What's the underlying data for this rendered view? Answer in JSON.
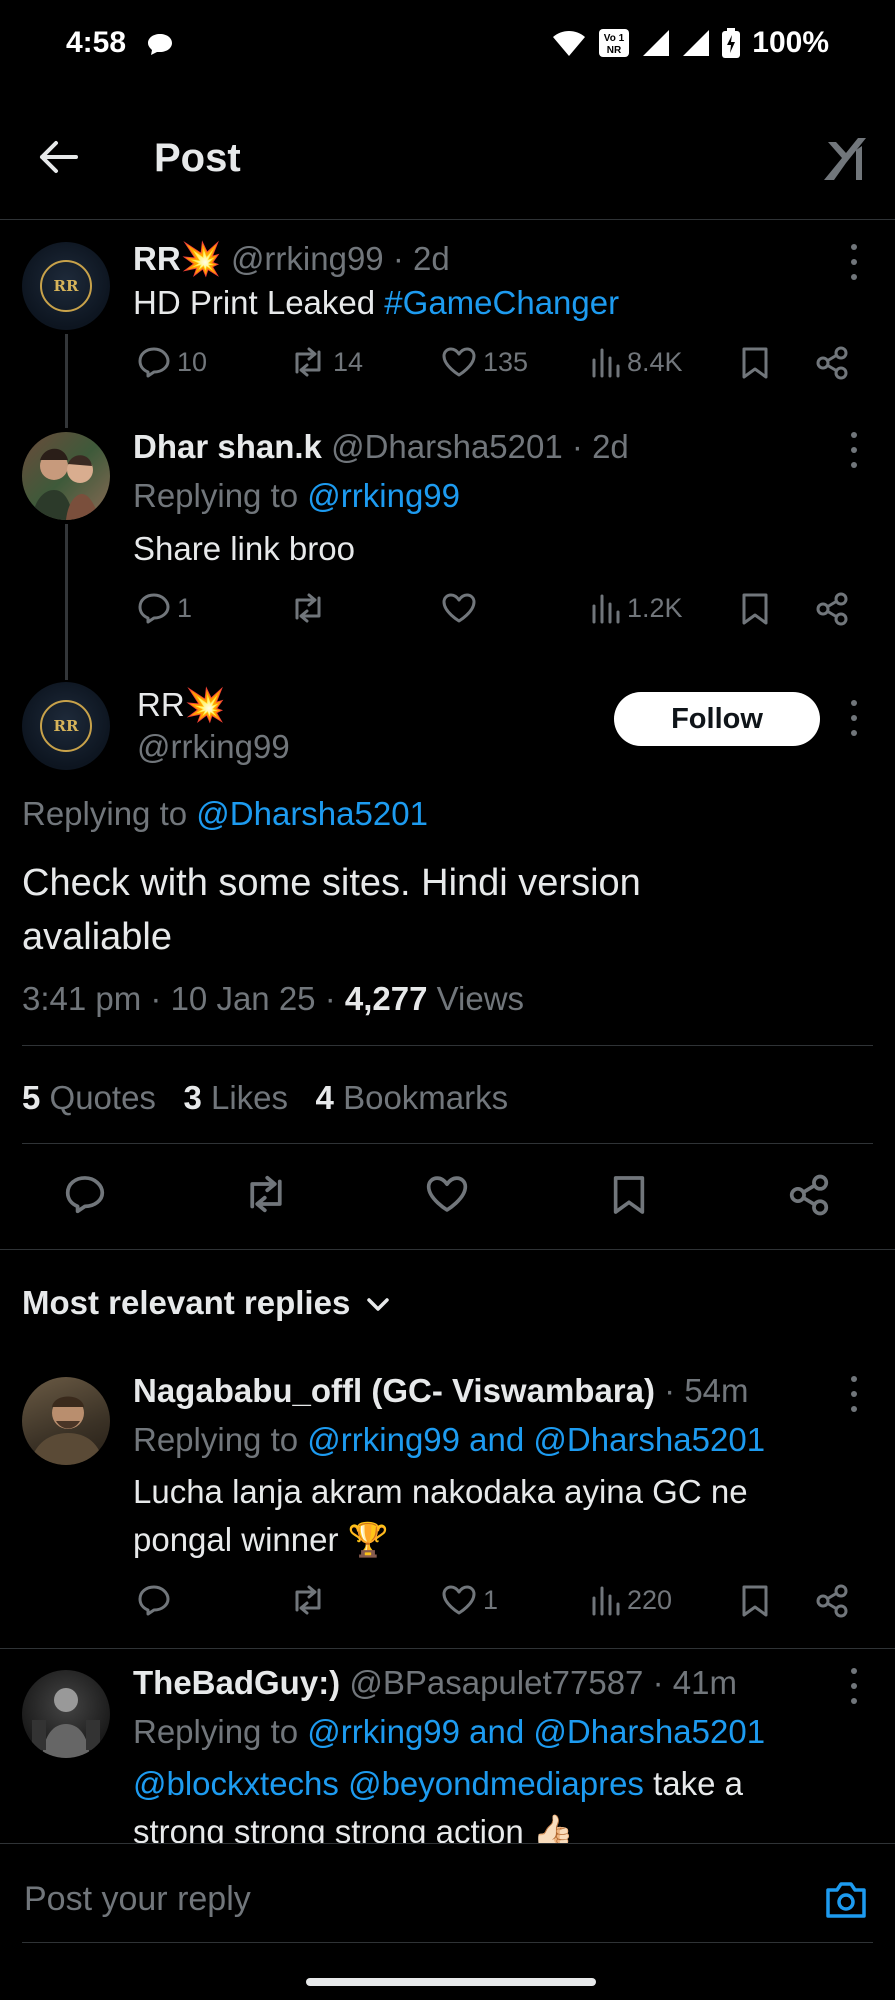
{
  "status_bar": {
    "time": "4:58",
    "battery": "100%",
    "volte": "Vo NR"
  },
  "header": {
    "title": "Post"
  },
  "parent_post": {
    "display_name": "RR💥",
    "handle": "@rrking99",
    "age": "· 2d",
    "text": "HD Print Leaked",
    "hashtag": "#GameChanger",
    "replies": "10",
    "reposts": "14",
    "likes": "135",
    "views": "8.4K"
  },
  "reply_post": {
    "display_name": "Dhar shan.k",
    "handle": "@Dharsha5201",
    "age": "· 2d",
    "replying_prefix": "Replying to",
    "replying_to": "@rrking99",
    "text": "Share link broo",
    "replies": "1",
    "views": "1.2K"
  },
  "main_post": {
    "avatar_text": "RR",
    "display_name": "RR💥",
    "handle": "@rrking99",
    "follow_label": "Follow",
    "replying_prefix": "Replying to",
    "replying_to": "@Dharsha5201",
    "text_line1": "Check with some sites.  Hindi version",
    "text_line2": "avaliable",
    "timestamp": "3:41 pm · 10 Jan 25 ·",
    "views_count": "4,277",
    "views_label": "Views",
    "quotes_count": "5",
    "quotes_label": "Quotes",
    "likes_count": "3",
    "likes_label": "Likes",
    "bookmarks_count": "4",
    "bookmarks_label": "Bookmarks"
  },
  "replies_section": {
    "sort_label": "Most relevant replies"
  },
  "reply1": {
    "display_name": "Nagababu_offl (GC- Viswambara)",
    "age": "· 54m",
    "replying_prefix": "Replying to",
    "replying_to": "@rrking99 and @Dharsha5201",
    "text_line1": "Lucha lanja akram nakodaka ayina GC ne",
    "text_line2": "pongal winner 🏆",
    "likes": "1",
    "views": "220"
  },
  "reply2": {
    "display_name": "TheBadGuy:)",
    "handle": "@BPasapulet77587",
    "age": "· 41m",
    "replying_prefix": "Replying to",
    "replying_to": "@rrking99 and @Dharsha5201",
    "mentions": "@blockxtechs @beyondmediapres",
    "text_line1_rest": "take a",
    "text_line2": "strong strong strong action 👍🏻"
  },
  "composer": {
    "placeholder": "Post your reply"
  },
  "colors": {
    "accent": "#1d9bf0",
    "background": "#000000",
    "muted": "#71767b"
  }
}
